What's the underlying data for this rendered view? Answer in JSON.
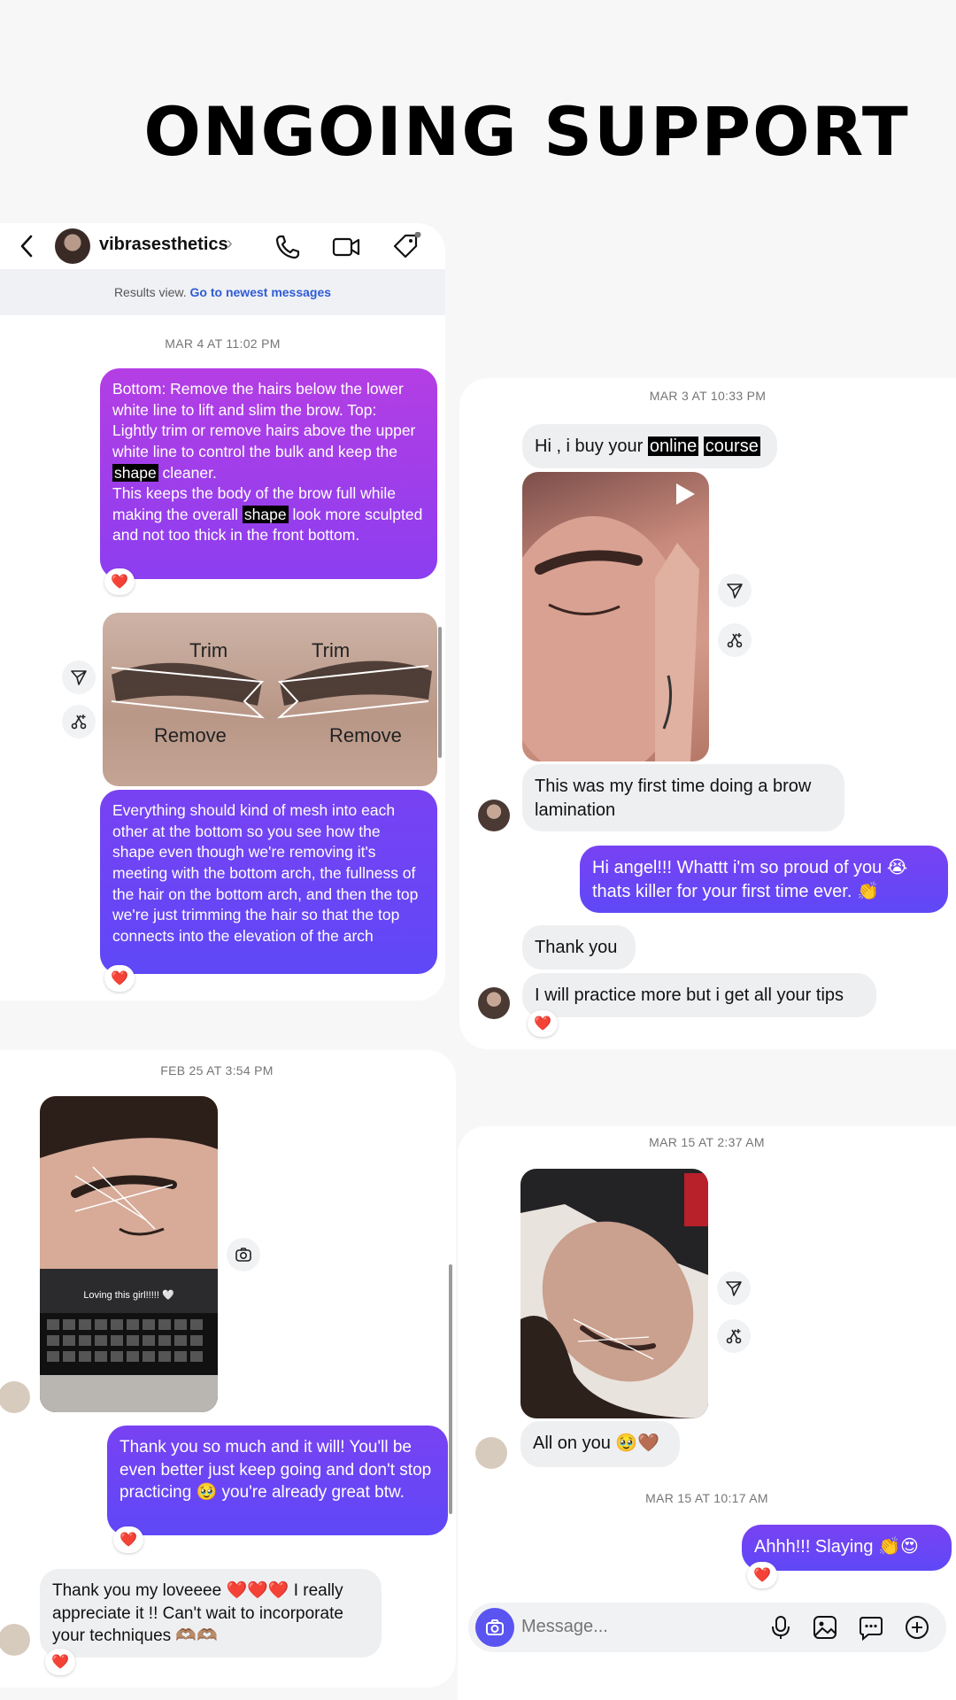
{
  "page": {
    "headline": "ONGOING SUPPORT"
  },
  "panel1": {
    "username": "vibrasesthetics",
    "results_text": "Results view.",
    "results_link": "Go to newest messages",
    "timestamp": "MAR 4 AT 11:02 PM",
    "msg1_parts": [
      "Bottom: Remove the hairs below the lower white line to lift and slim the brow. Top: Lightly trim or remove hairs above the upper white line to control the bulk and keep the ",
      "shape",
      " cleaner.",
      "This keeps the body of the brow full while making the overall ",
      "shape",
      " look more sculpted and not too thick in the front bottom."
    ],
    "image_labels": [
      "Trim",
      "Trim",
      "Remove",
      "Remove"
    ],
    "msg2": "Everything should kind of mesh into each other at the bottom so you see how the shape even though we're removing it's meeting with the bottom arch, the fullness of the hair on the bottom arch, and then the top we're just trimming the hair so that the top connects into the elevation of the arch"
  },
  "panel2": {
    "timestamp": "MAR 3 AT 10:33 PM",
    "msg1_parts": [
      "Hi , i buy your ",
      "online",
      " ",
      "course"
    ],
    "msg2": "This was my first time doing a brow lamination",
    "msg3": "Hi angel!!! Whattt i'm so proud of you 😭 thats killer for your first time ever. 👏",
    "msg4": "Thank you",
    "msg5": "I will practice more but i get all your tips"
  },
  "panel3": {
    "timestamp": "FEB 25 AT 3:54 PM",
    "story_caption": "Loving this girl!!!!! 🤍",
    "msg1": "Thank you so much and it will! You'll be even better just keep going and don't stop practicing 🥹 you're already great btw.",
    "msg2": "Thank you my loveeee ❤️❤️❤️ I really appreciate it !! Can't wait to incorporate your techniques 🫶🏽🫶🏽"
  },
  "panel4": {
    "timestamp1": "MAR 15 AT 2:37 AM",
    "msg1": "All on you 🥹🤎",
    "timestamp2": "MAR 15 AT 10:17 AM",
    "msg2": "Ahhh!!! Slaying 👏😍",
    "composer_placeholder": "Message..."
  },
  "reaction": "❤️",
  "colors": {
    "purple": "#b43ee4",
    "indigo": "#6448f6",
    "link": "#2f5bd6",
    "camera": "#5a55f0"
  },
  "icons": [
    "back-icon",
    "phone-icon",
    "video-icon",
    "tag-icon",
    "share-icon",
    "remix-icon",
    "play-icon",
    "camera-icon",
    "mic-icon",
    "gallery-icon",
    "sticker-icon",
    "plus-icon"
  ]
}
